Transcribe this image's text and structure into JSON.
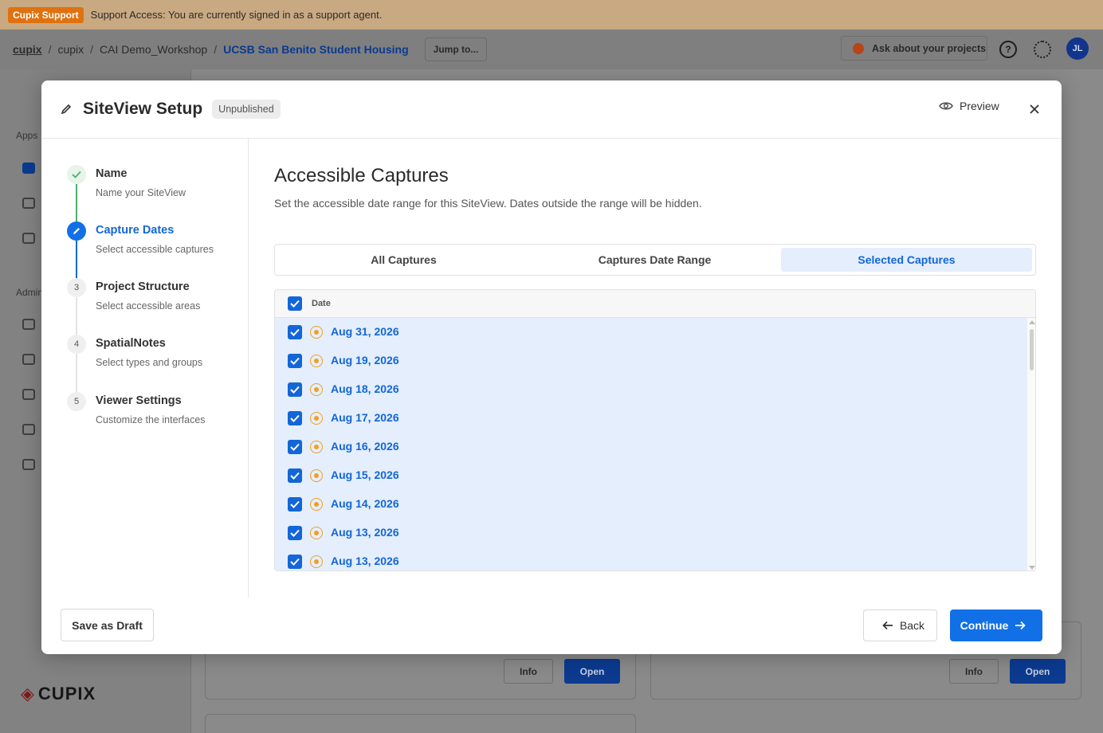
{
  "support": {
    "badge": "Cupix Support",
    "message": "Support Access: You are currently signed in as a support agent."
  },
  "topnav": {
    "brand": "cupix",
    "breadcrumbs": [
      "cupix",
      "CAI Demo_Workshop",
      "UCSB San Benito Student Housing"
    ],
    "jump_label": "Jump to...",
    "ask_label": "Ask about your projects",
    "avatar_initials": "JL"
  },
  "bg_sidebar": {
    "apps_label": "Apps",
    "admin_label": "Admin",
    "logo_text": "CUPIX"
  },
  "bg_cards": {
    "info_label": "Info",
    "open_label": "Open"
  },
  "modal": {
    "title": "SiteView Setup",
    "status": "Unpublished",
    "preview_label": "Preview"
  },
  "steps": [
    {
      "number": "",
      "title": "Name",
      "subtitle": "Name your SiteView",
      "state": "done"
    },
    {
      "number": "",
      "title": "Capture Dates",
      "subtitle": "Select accessible captures",
      "state": "active"
    },
    {
      "number": "3",
      "title": "Project Structure",
      "subtitle": "Select accessible areas",
      "state": "pending"
    },
    {
      "number": "4",
      "title": "SpatialNotes",
      "subtitle": "Select types and groups",
      "state": "pending"
    },
    {
      "number": "5",
      "title": "Viewer Settings",
      "subtitle": "Customize the interfaces",
      "state": "pending"
    }
  ],
  "content": {
    "title": "Accessible Captures",
    "description": "Set the accessible date range for this SiteView. Dates outside the range will be hidden.",
    "tabs": [
      {
        "label": "All Captures",
        "active": false
      },
      {
        "label": "Captures Date Range",
        "active": false
      },
      {
        "label": "Selected Captures",
        "active": true
      }
    ],
    "table_header": "Date",
    "rows": [
      {
        "date": "Aug 31, 2026",
        "checked": true
      },
      {
        "date": "Aug 19, 2026",
        "checked": true
      },
      {
        "date": "Aug 18, 2026",
        "checked": true
      },
      {
        "date": "Aug 17, 2026",
        "checked": true
      },
      {
        "date": "Aug 16, 2026",
        "checked": true
      },
      {
        "date": "Aug 15, 2026",
        "checked": true
      },
      {
        "date": "Aug 14, 2026",
        "checked": true
      },
      {
        "date": "Aug 13, 2026",
        "checked": true
      },
      {
        "date": "Aug 13, 2026",
        "checked": true
      }
    ]
  },
  "footer": {
    "draft_label": "Save as Draft",
    "back_label": "Back",
    "continue_label": "Continue"
  },
  "colors": {
    "accent": "#1170e6",
    "selected_row": "#e4eefc",
    "capture_icon": "#f0a020",
    "support_badge": "#e0710f"
  }
}
